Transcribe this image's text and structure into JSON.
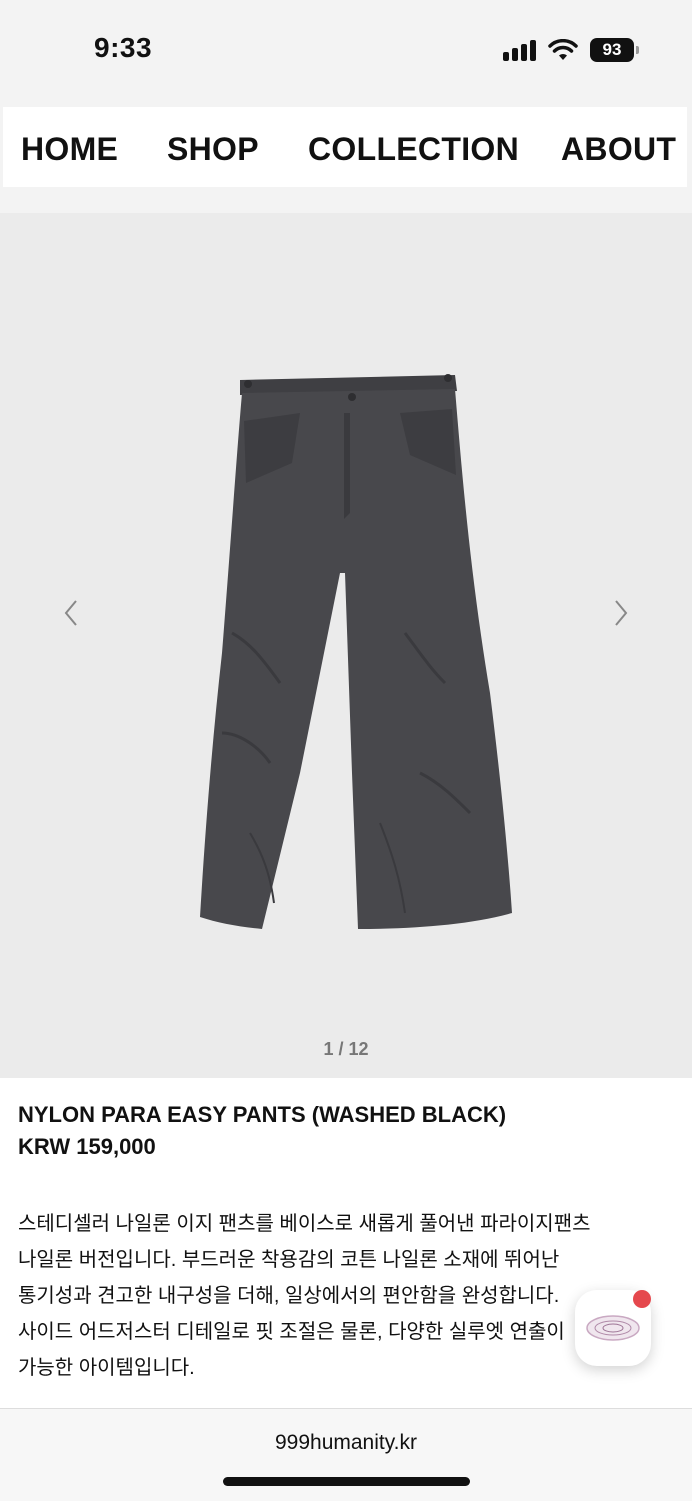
{
  "status": {
    "time": "9:33",
    "battery": "93"
  },
  "nav": {
    "items": [
      "HOME",
      "SHOP",
      "COLLECTION",
      "ABOUT"
    ]
  },
  "gallery": {
    "counter": "1 / 12",
    "prev_icon": "chevron-left-icon",
    "next_icon": "chevron-right-icon"
  },
  "product": {
    "name": "NYLON PARA EASY PANTS (WASHED BLACK)",
    "price": "KRW 159,000",
    "description": "스테디셀러 나일론 이지 팬츠를 베이스로 새롭게 풀어낸 파라이지팬츠\n나일론 버전입니다. 부드러운 착용감의 코튼 나일론 소재에 뛰어난\n통기성과 견고한 내구성을 더해, 일상에서의 편안함을 완성합니다.\n사이드 어드저스터 디테일로 핏 조절은 물론, 다양한 실루엣 연출이\n가능한 아이템입니다."
  },
  "browser": {
    "url": "999humanity.kr"
  },
  "colors": {
    "pants": "#48484c",
    "notification": "#e5484d"
  }
}
